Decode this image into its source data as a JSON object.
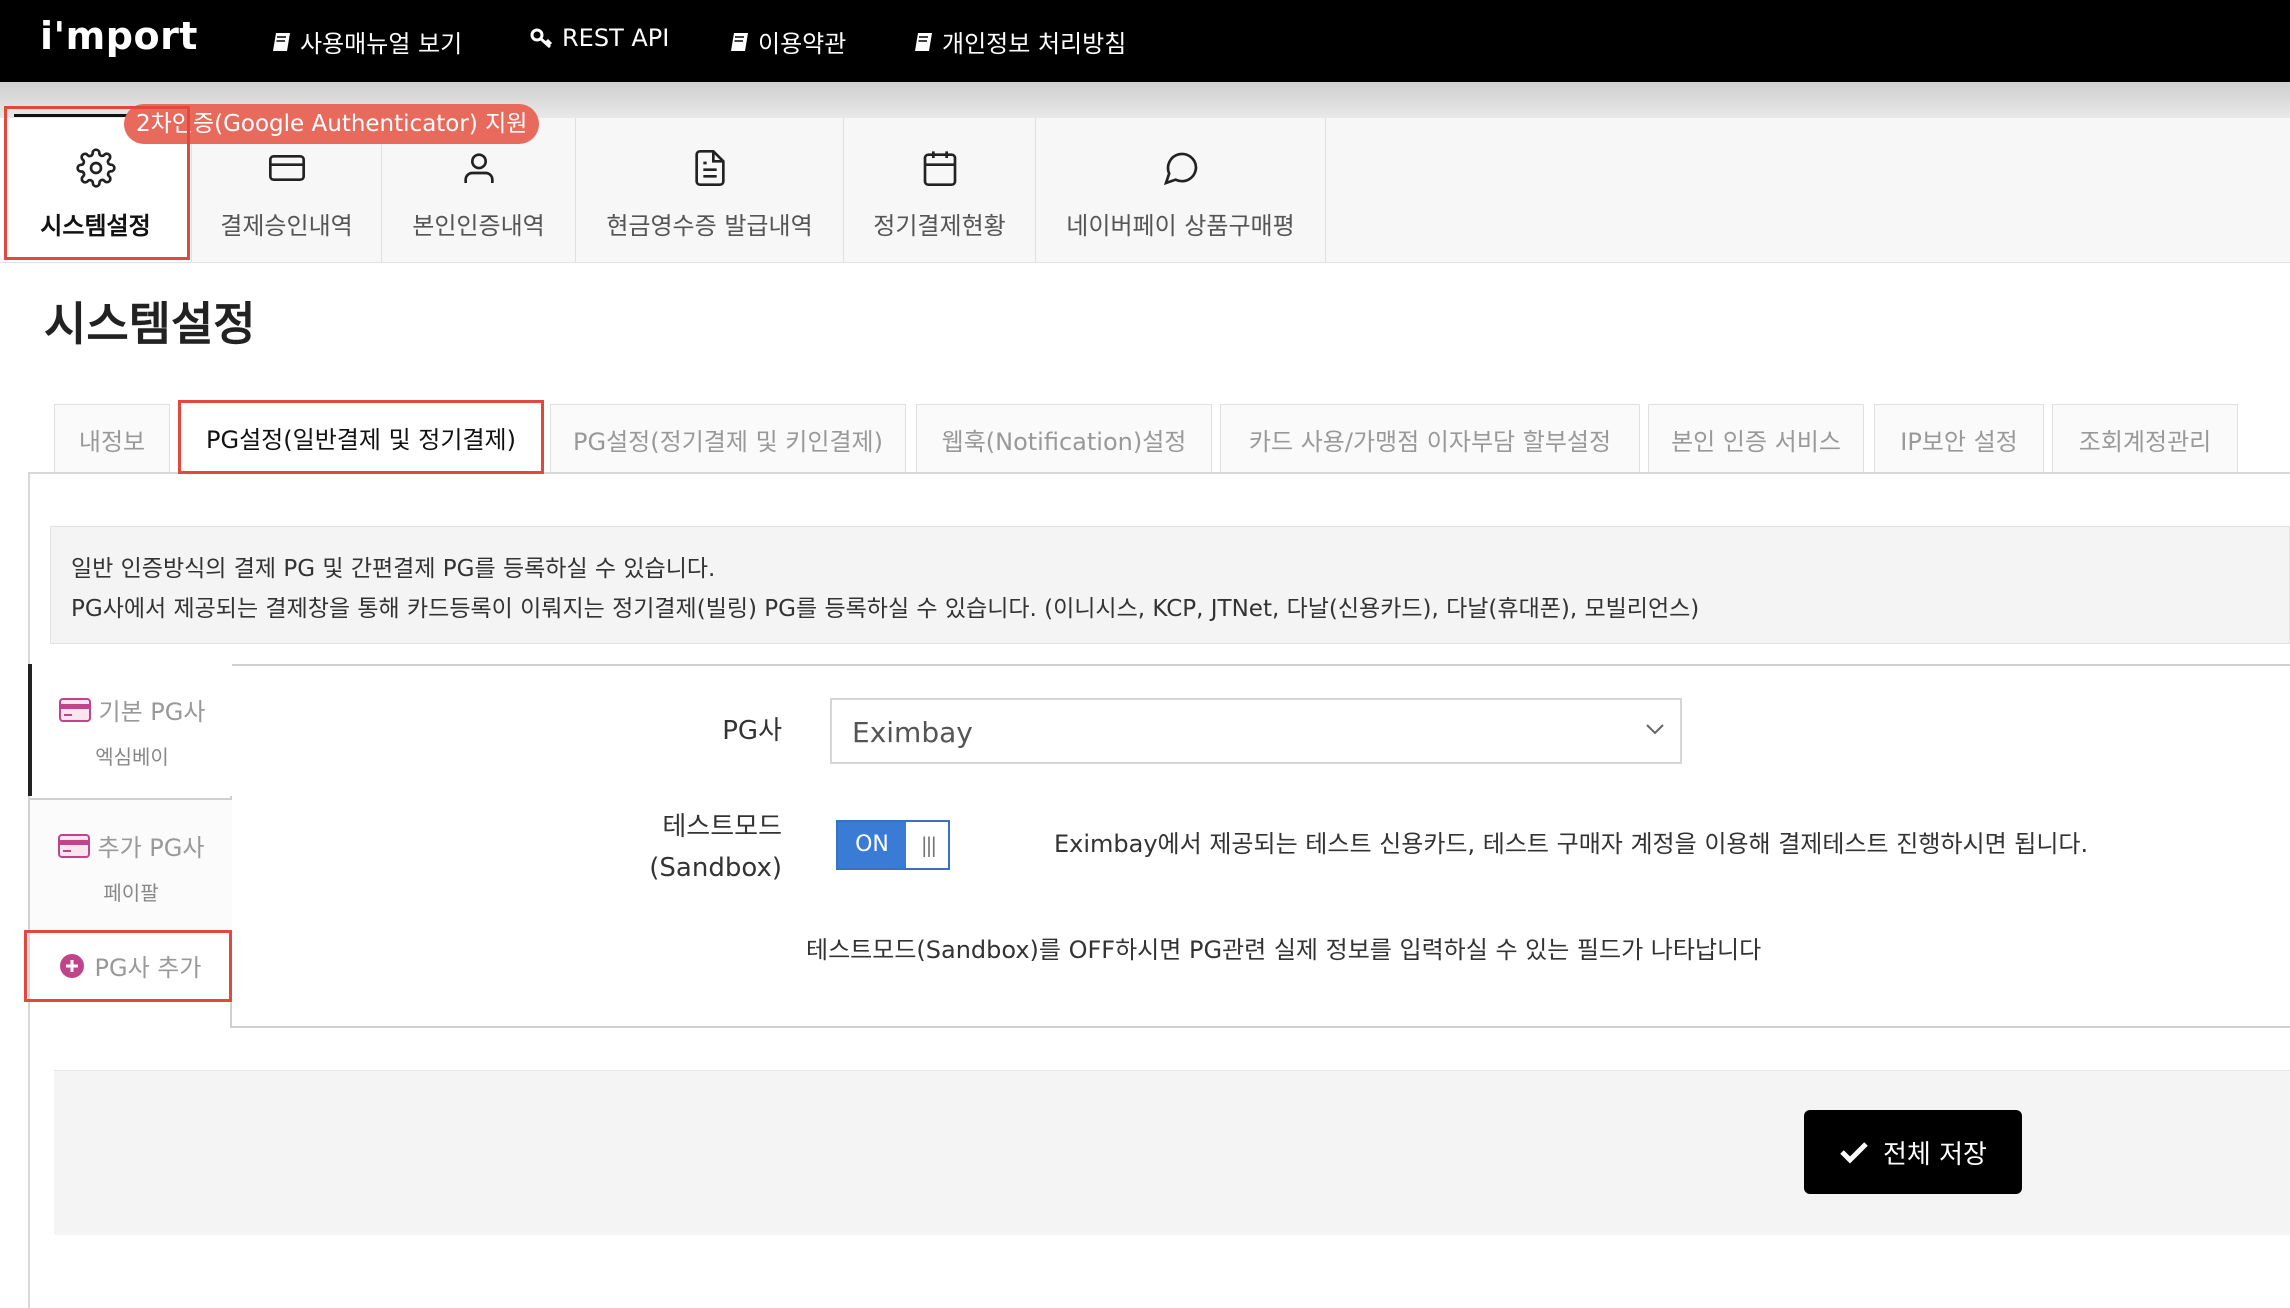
{
  "topbar": {
    "logo": "i'mport",
    "nav": [
      {
        "label": "사용매뉴얼 보기",
        "icon": "book-icon"
      },
      {
        "label": "REST API",
        "icon": "key-icon"
      },
      {
        "label": "이용약관",
        "icon": "book-icon"
      },
      {
        "label": "개인정보 처리방침",
        "icon": "book-icon"
      }
    ]
  },
  "menu": {
    "badge": "2차인증(Google Authenticator) 지원",
    "tabs": [
      {
        "label": "시스템설정",
        "icon": "gear-icon"
      },
      {
        "label": "결제승인내역",
        "icon": "credit-card-icon"
      },
      {
        "label": "본인인증내역",
        "icon": "user-icon"
      },
      {
        "label": "현금영수증 발급내역",
        "icon": "document-icon"
      },
      {
        "label": "정기결제현황",
        "icon": "calendar-icon"
      },
      {
        "label": "네이버페이 상품구매평",
        "icon": "chat-bubble-icon"
      }
    ]
  },
  "page": {
    "title": "시스템설정"
  },
  "subtabs": [
    {
      "label": "내정보"
    },
    {
      "label": "PG설정(일반결제 및 정기결제)"
    },
    {
      "label": "PG설정(정기결제 및 키인결제)"
    },
    {
      "label": "웹훅(Notification)설정"
    },
    {
      "label": "카드 사용/가맹점 이자부담 할부설정"
    },
    {
      "label": "본인 인증 서비스"
    },
    {
      "label": "IP보안 설정"
    },
    {
      "label": "조회계정관리"
    }
  ],
  "info": {
    "line1": "일반 인증방식의 결제 PG 및 간편결제 PG를 등록하실 수 있습니다.",
    "line2": "PG사에서 제공되는 결제창을 통해 카드등록이 이뤄지는 정기결제(빌링) PG를 등록하실 수 있습니다. (이니시스, KCP, JTNet, 다날(신용카드), 다날(휴대폰), 모빌리언스)"
  },
  "pg_sidebar": {
    "items": [
      {
        "title": "기본 PG사",
        "sub": "엑심베이"
      },
      {
        "title": "추가 PG사",
        "sub": "페이팔"
      }
    ],
    "add_label": "PG사 추가"
  },
  "form": {
    "pg_label": "PG사",
    "pg_value": "Eximbay",
    "test_label_1": "테스트모드",
    "test_label_2": "(Sandbox)",
    "toggle_on": "ON",
    "toggle_handle": "|||",
    "test_desc": "Eximbay에서 제공되는 테스트 신용카드, 테스트 구매자 계정을 이용해 결제테스트 진행하시면 됩니다.",
    "sandbox_note": "테스트모드(Sandbox)를 OFF하시면 PG관련 실제 정보를 입력하실 수 있는 필드가 나타납니다"
  },
  "actions": {
    "save_all": "전체 저장"
  },
  "colors": {
    "accent": "#3a7bd5",
    "highlight": "#e4473b",
    "badge": "#e86a5c",
    "card_icon": "#c0448a"
  }
}
